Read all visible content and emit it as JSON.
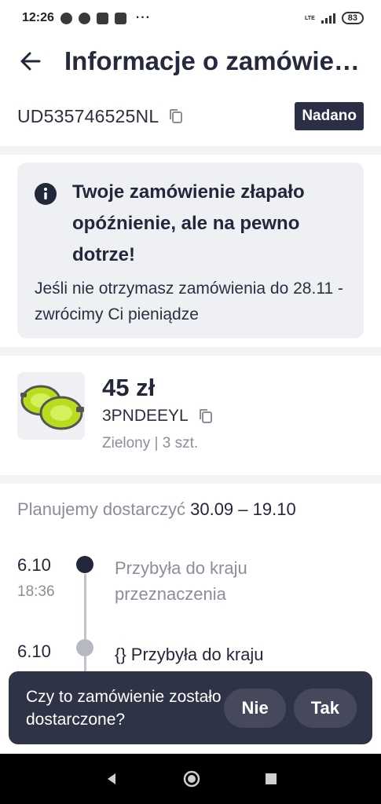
{
  "status_bar": {
    "time": "12:26",
    "more": "···",
    "network": "LTE",
    "battery": "83"
  },
  "app_bar": {
    "title": "Informacje o zamówie…"
  },
  "shipment": {
    "tracking_number": "UD535746525NL",
    "status_badge": "Nadano"
  },
  "notice": {
    "title": "Twoje zamówienie złapało opóźnienie, ale na pewno dotrze!",
    "body": "Jeśli nie otrzymasz zamówienia do 28.11 - zwrócimy Ci pieniądze"
  },
  "product": {
    "price": "45 zł",
    "code": "3PNDEEYL",
    "variant": "Zielony | 3 szt."
  },
  "delivery_plan": {
    "label": "Planujemy dostarczyć",
    "range": "30.09 – 19.10"
  },
  "timeline": [
    {
      "date": "6.10",
      "time": "18:36",
      "text": "Przybyła do kraju przeznaczenia"
    },
    {
      "date": "6.10",
      "time": "",
      "text": "{} Przybyła do kraju przeznaczenia"
    }
  ],
  "snackbar": {
    "question": "Czy to zamówienie zostało dostarczone?",
    "no_label": "Nie",
    "yes_label": "Tak"
  },
  "colors": {
    "badge_bg": "#2a2f45",
    "snackbar_bg": "#2f3346",
    "muted_text": "#8a8e9a",
    "product_green": "#b9dc1e"
  }
}
